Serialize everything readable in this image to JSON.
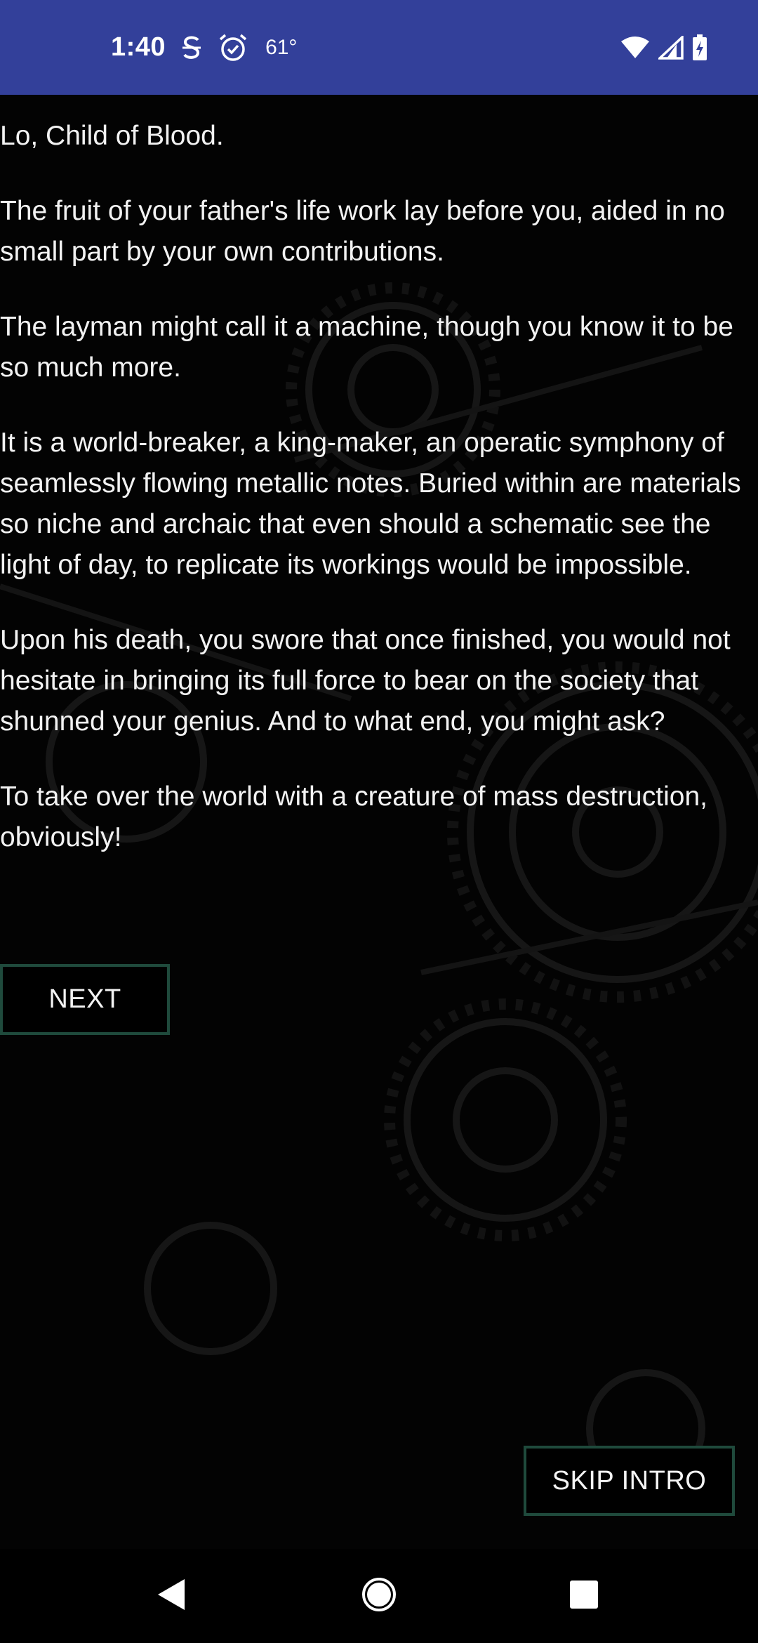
{
  "status_bar": {
    "time": "1:40",
    "temperature": "61°",
    "icons": [
      "s-app-icon",
      "alarm-icon",
      "wifi-icon",
      "signal-icon",
      "battery-charging-icon"
    ],
    "background": "#33409a"
  },
  "story": {
    "paragraphs": [
      "Lo, Child of Blood.",
      "The fruit of your father's life work lay before you, aided in no small part by your own contributions.",
      "The layman might call it a machine, though you know it to be so much more.",
      "It is a world-breaker, a king-maker, an operatic symphony of seamlessly flowing metallic notes. Buried within are materials so niche and archaic that even should a schematic see the light of day, to replicate its workings would be impossible.",
      "Upon his death, you swore that once finished, you would not hesitate in bringing its full force to bear on the society that shunned your genius. And to what end, you might ask?",
      "To take over the world with a creature of mass destruction, obviously!"
    ]
  },
  "buttons": {
    "next_label": "NEXT",
    "skip_label": "SKIP INTRO",
    "border_color": "#1f4a3c"
  },
  "nav_bar": {
    "icons": [
      "back-icon",
      "home-icon",
      "recents-icon"
    ]
  }
}
